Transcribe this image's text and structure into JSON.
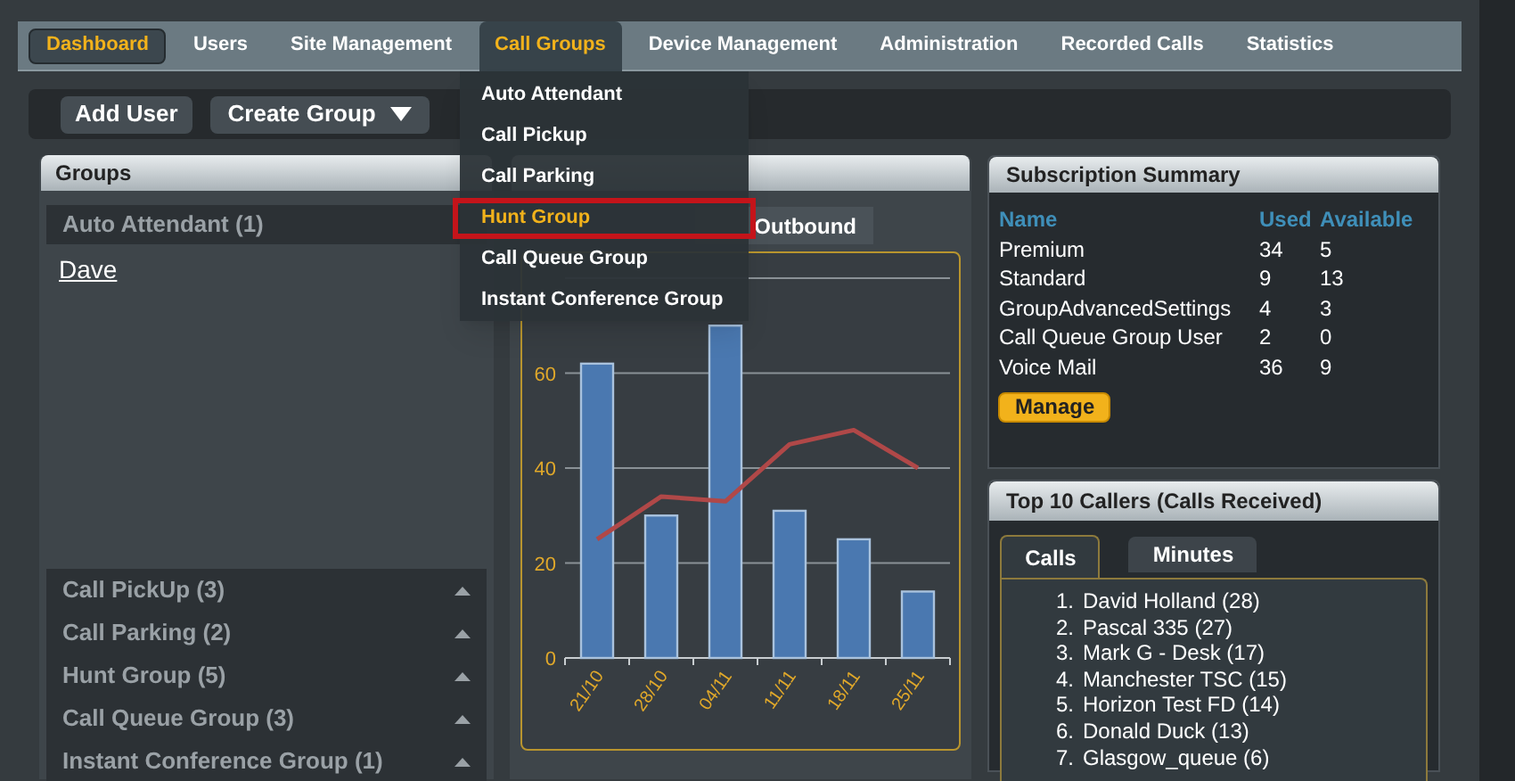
{
  "nav": [
    {
      "label": "Dashboard",
      "selected": true,
      "expanded": false
    },
    {
      "label": "Users",
      "selected": false,
      "expanded": false
    },
    {
      "label": "Site Management",
      "selected": false,
      "expanded": false
    },
    {
      "label": "Call Groups",
      "selected": false,
      "expanded": true
    },
    {
      "label": "Device Management",
      "selected": false,
      "expanded": false
    },
    {
      "label": "Administration",
      "selected": false,
      "expanded": false
    },
    {
      "label": "Recorded Calls",
      "selected": false,
      "expanded": false
    },
    {
      "label": "Statistics",
      "selected": false,
      "expanded": false
    }
  ],
  "call_groups_menu": [
    {
      "label": "Auto Attendant",
      "selected": false
    },
    {
      "label": "Call Pickup",
      "selected": false
    },
    {
      "label": "Call Parking",
      "selected": false
    },
    {
      "label": "Hunt Group",
      "selected": true
    },
    {
      "label": "Call Queue Group",
      "selected": false
    },
    {
      "label": "Instant Conference Group",
      "selected": false
    }
  ],
  "toolbar": {
    "add_user": "Add User",
    "create_group": "Create Group"
  },
  "groups": {
    "title": "Groups",
    "items": [
      {
        "label": "Auto Attendant (1)",
        "expanded": true,
        "children": [
          {
            "label": "Dave"
          }
        ]
      },
      {
        "label": "Call PickUp (3)",
        "expanded": false
      },
      {
        "label": "Call Parking (2)",
        "expanded": false
      },
      {
        "label": "Hunt Group (5)",
        "expanded": false
      },
      {
        "label": "Call Queue Group (3)",
        "expanded": false
      },
      {
        "label": "Instant Conference Group (1)",
        "expanded": false
      }
    ]
  },
  "calls_chart": {
    "tabs": [
      {
        "label": "Outbound",
        "selected": false
      }
    ],
    "chart_data": {
      "type": "bar",
      "categories": [
        "21/10",
        "28/10",
        "04/11",
        "11/11",
        "18/11",
        "25/11"
      ],
      "series": [
        {
          "type": "bar",
          "color": "#4a78b0",
          "values": [
            62,
            30,
            70,
            31,
            25,
            14
          ]
        },
        {
          "type": "line",
          "color": "#b04848",
          "values": [
            25,
            34,
            33,
            45,
            48,
            40
          ]
        }
      ],
      "ylim": [
        0,
        80
      ],
      "grid": true,
      "yticks": [
        0,
        20,
        40,
        60
      ]
    }
  },
  "subscription": {
    "title": "Subscription Summary",
    "columns": [
      "Name",
      "Used",
      "Available"
    ],
    "rows": [
      [
        "Premium",
        "34",
        "5"
      ],
      [
        "Standard",
        "9",
        "13"
      ],
      [
        "GroupAdvancedSettings",
        "4",
        "3"
      ],
      [
        "Call Queue Group User",
        "2",
        "0"
      ],
      [
        "Voice Mail",
        "36",
        "9"
      ]
    ],
    "manage": "Manage"
  },
  "top_callers": {
    "title": "Top 10 Callers (Calls Received)",
    "tabs": [
      {
        "label": "Calls",
        "selected": true
      },
      {
        "label": "Minutes",
        "selected": false
      }
    ],
    "items": [
      {
        "number": "1.",
        "label": "David Holland (28)"
      },
      {
        "number": "2.",
        "label": "Pascal 335 (27)"
      },
      {
        "number": "3.",
        "label": "Mark G - Desk (17)"
      },
      {
        "number": "4.",
        "label": "Manchester TSC (15)"
      },
      {
        "number": "5.",
        "label": "Horizon Test FD (14)"
      },
      {
        "number": "6.",
        "label": "Donald Duck (13)"
      },
      {
        "number": "7.",
        "label": "Glasgow_queue (6)"
      }
    ]
  }
}
